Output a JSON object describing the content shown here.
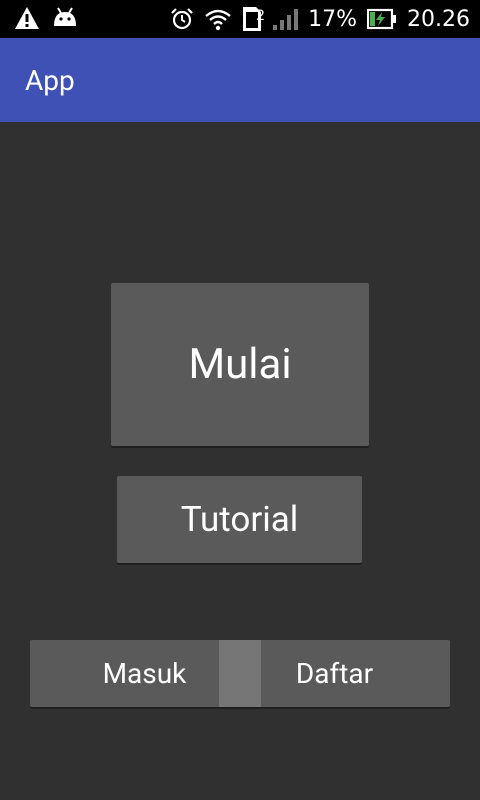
{
  "status_bar": {
    "sim_slot": "2",
    "battery_percent": "17%",
    "time": "20.26",
    "icons": [
      "warning-icon",
      "android-icon",
      "alarm-icon",
      "wifi-icon",
      "sim-icon",
      "signal-icon",
      "battery-charging-icon"
    ]
  },
  "app_bar": {
    "title": "App",
    "color": "#3F51B5"
  },
  "main": {
    "start_label": "Mulai",
    "tutorial_label": "Tutorial",
    "login_label": "Masuk",
    "register_label": "Daftar"
  },
  "colors": {
    "background": "#303030",
    "button": "#5A5A5A",
    "thumb": "#767676"
  }
}
